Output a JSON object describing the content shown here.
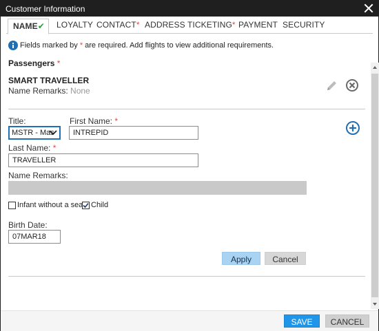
{
  "window": {
    "title": "Customer Information"
  },
  "tabs": [
    {
      "label": "NAME",
      "check": "✔",
      "active": true
    },
    {
      "label": "LOYALTY",
      "required": ""
    },
    {
      "label": "CONTACT",
      "required": "*"
    },
    {
      "label": "ADDRESS",
      "required": ""
    },
    {
      "label": "TICKETING",
      "required": "*"
    },
    {
      "label": "PAYMENT",
      "required": ""
    },
    {
      "label": "SECURITY",
      "required": ""
    }
  ],
  "info": {
    "text_before": "Fields marked by ",
    "asterisk": "*",
    "text_after": " are required. Add flights to view additional requirements."
  },
  "passengers": {
    "title": "Passengers",
    "required": "*",
    "existing": {
      "name": "SMART TRAVELLER",
      "remarks_label": "Name Remarks:",
      "remarks_value": "None"
    }
  },
  "form": {
    "title_label": "Title:",
    "title_value": "MSTR - Mas",
    "first_name_label": "First Name:",
    "first_name_value": "INTREPID",
    "last_name_label": "Last Name:",
    "last_name_value": "TRAVELLER",
    "name_remarks_label": "Name Remarks:",
    "infant_label": "Infant without a seat",
    "infant_checked": false,
    "child_label": "Child",
    "child_checked": true,
    "birth_date_label": "Birth Date:",
    "birth_date_value": "07MAR18",
    "required": "*",
    "apply_label": "Apply",
    "cancel_label": "Cancel"
  },
  "footer": {
    "save_label": "SAVE",
    "cancel_label": "CANCEL"
  },
  "colors": {
    "accent": "#2196e8",
    "required": "#e0493f",
    "check": "#1f9f3e",
    "title_bar": "#1f1f1f"
  },
  "icons": [
    "close-icon",
    "info-icon",
    "pencil-icon",
    "remove-circle-icon",
    "add-circle-icon",
    "chevron-down-icon",
    "checkbox-check-icon",
    "scroll-up-icon",
    "scroll-down-icon"
  ]
}
